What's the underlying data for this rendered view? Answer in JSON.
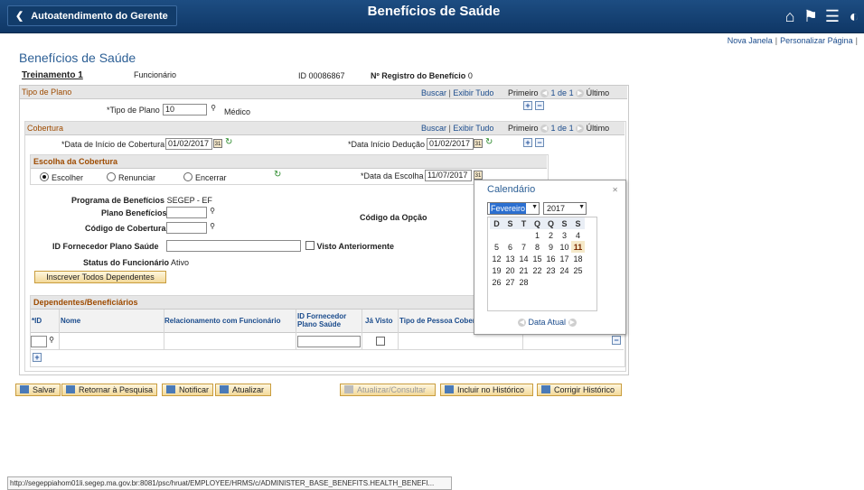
{
  "banner": {
    "back_label": "Autoatendimento do Gerente",
    "title": "Benefícios de Saúde"
  },
  "toplinks": {
    "new_window": "Nova Janela",
    "personalize": "Personalizar Página",
    "sep": "|"
  },
  "page_title": "Benefícios de Saúde",
  "header": {
    "job_title": "Treinamento 1",
    "job_role": "Funcionário",
    "id_label": "ID",
    "id_value": "00086867",
    "reg_label": "Nº Registro do Benefício",
    "reg_value": "0"
  },
  "nav": {
    "search": "Buscar",
    "view_all": "Exibir Tudo",
    "first": "Primeiro",
    "count": "1 de 1",
    "last": "Último",
    "sep": "|"
  },
  "plan_section": {
    "title": "Tipo de Plano",
    "plan_type_label": "*Tipo de Plano",
    "plan_type_value": "10",
    "plan_type_desc": "Médico"
  },
  "coverage_section": {
    "title": "Cobertura",
    "start_label": "*Data de Início de Cobertura",
    "start_value": "01/02/2017",
    "deduction_label": "*Data Início Dedução",
    "deduction_value": "01/02/2017"
  },
  "choice_section": {
    "title": "Escolha da Cobertura",
    "opt_choose": "Escolher",
    "opt_waive": "Renunciar",
    "opt_terminate": "Encerrar",
    "choice_date_label": "*Data da Escolha",
    "choice_date_value": "11/07/2017"
  },
  "details": {
    "program_label": "Programa de Benefícios",
    "program_value": "SEGEP - EF",
    "benefit_plan_label": "Plano Benefícios",
    "coverage_code_label": "Código de Cobertura",
    "option_code_label": "Código da Opção",
    "provider_label": "ID Fornecedor Plano Saúde",
    "seen_label": "Visto Anteriormente",
    "status_label": "Status do Funcionário",
    "status_value": "Ativo",
    "enroll_all_label": "Inscrever Todos Dependentes"
  },
  "dependents": {
    "title": "Dependentes/Beneficiários",
    "col_id": "*ID",
    "col_name": "Nome",
    "col_relationship": "Relacionamento com Funcionário",
    "col_provider_1": "ID Fornecedor",
    "col_provider_2": "Plano Saúde",
    "col_seen": "Já Visto",
    "col_person_type": "Tipo de Pessoa Cobert"
  },
  "buttons": {
    "save": "Salvar",
    "return_search": "Retornar à Pesquisa",
    "notify": "Notificar",
    "refresh": "Atualizar",
    "update_display": "Atualizar/Consultar",
    "include_history": "Incluir no Histórico",
    "correct_history": "Corrigir Histórico"
  },
  "calendar": {
    "title": "Calendário",
    "month": "Fevereiro",
    "year": "2017",
    "weekdays": [
      "D",
      "S",
      "T",
      "Q",
      "Q",
      "S",
      "S"
    ],
    "weeks": [
      [
        "",
        "",
        "",
        "1",
        "2",
        "3",
        "4"
      ],
      [
        "5",
        "6",
        "7",
        "8",
        "9",
        "10",
        "11"
      ],
      [
        "12",
        "13",
        "14",
        "15",
        "16",
        "17",
        "18"
      ],
      [
        "19",
        "20",
        "21",
        "22",
        "23",
        "24",
        "25"
      ],
      [
        "26",
        "27",
        "28",
        "",
        "",
        "",
        ""
      ]
    ],
    "today_label": "Data Atual"
  },
  "status_url": "http://segeppiahom01li.segep.ma.gov.br:8081/psc/hruat/EMPLOYEE/HRMS/c/ADMINISTER_BASE_BENEFITS.HEALTH_BENEFI..."
}
